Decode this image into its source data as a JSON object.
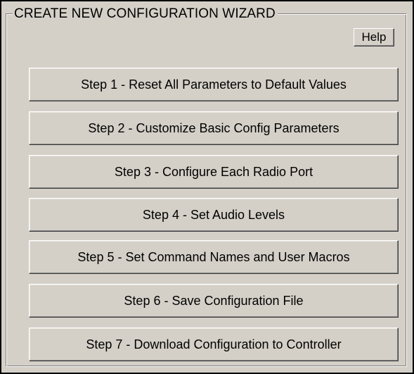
{
  "wizard": {
    "title": "CREATE NEW CONFIGURATION WIZARD",
    "help_label": "Help",
    "steps": [
      {
        "label": "Step 1 - Reset All Parameters to Default Values"
      },
      {
        "label": "Step 2 - Customize Basic Config Parameters"
      },
      {
        "label": "Step 3 - Configure Each Radio Port"
      },
      {
        "label": "Step 4 - Set Audio Levels"
      },
      {
        "label": "Step 5 - Set Command Names and User Macros"
      },
      {
        "label": "Step 6 - Save Configuration File"
      },
      {
        "label": "Step 7 - Download Configuration to Controller"
      }
    ]
  },
  "colors": {
    "face": "#d4d0c8",
    "highlight": "#ffffff",
    "shadow": "#808080",
    "dark_shadow": "#404040",
    "text": "#000000"
  }
}
